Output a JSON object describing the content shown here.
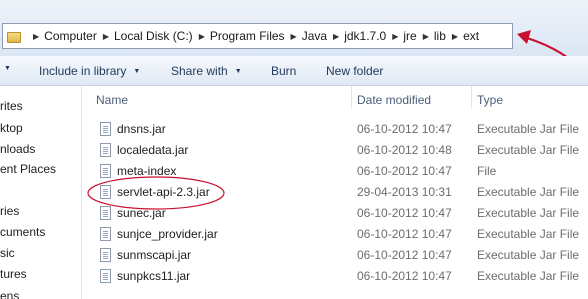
{
  "address": {
    "crumbs": [
      "Computer",
      "Local Disk (C:)",
      "Program Files",
      "Java",
      "jdk1.7.0",
      "jre",
      "lib",
      "ext"
    ]
  },
  "toolbar": {
    "include_label": "Include in library",
    "share_label": "Share with",
    "burn_label": "Burn",
    "new_folder_label": "New folder"
  },
  "nav": {
    "items": [
      "rites",
      "ktop",
      "nloads",
      "ent Places",
      "ries",
      "cuments",
      "sic",
      "tures",
      "ens"
    ]
  },
  "columns": {
    "name": "Name",
    "date": "Date modified",
    "type": "Type"
  },
  "files": [
    {
      "name": "dnsns.jar",
      "date": "06-10-2012 10:47",
      "type": "Executable Jar File"
    },
    {
      "name": "localedata.jar",
      "date": "06-10-2012 10:48",
      "type": "Executable Jar File"
    },
    {
      "name": "meta-index",
      "date": "06-10-2012 10:47",
      "type": "File"
    },
    {
      "name": "servlet-api-2.3.jar",
      "date": "29-04-2013 10:31",
      "type": "Executable Jar File"
    },
    {
      "name": "sunec.jar",
      "date": "06-10-2012 10:47",
      "type": "Executable Jar File"
    },
    {
      "name": "sunjce_provider.jar",
      "date": "06-10-2012 10:47",
      "type": "Executable Jar File"
    },
    {
      "name": "sunmscapi.jar",
      "date": "06-10-2012 10:47",
      "type": "Executable Jar File"
    },
    {
      "name": "sunpkcs11.jar",
      "date": "06-10-2012 10:47",
      "type": "Executable Jar File"
    }
  ],
  "colors": {
    "annotation": "#c8102e",
    "toolbar_text": "#1e395b"
  }
}
